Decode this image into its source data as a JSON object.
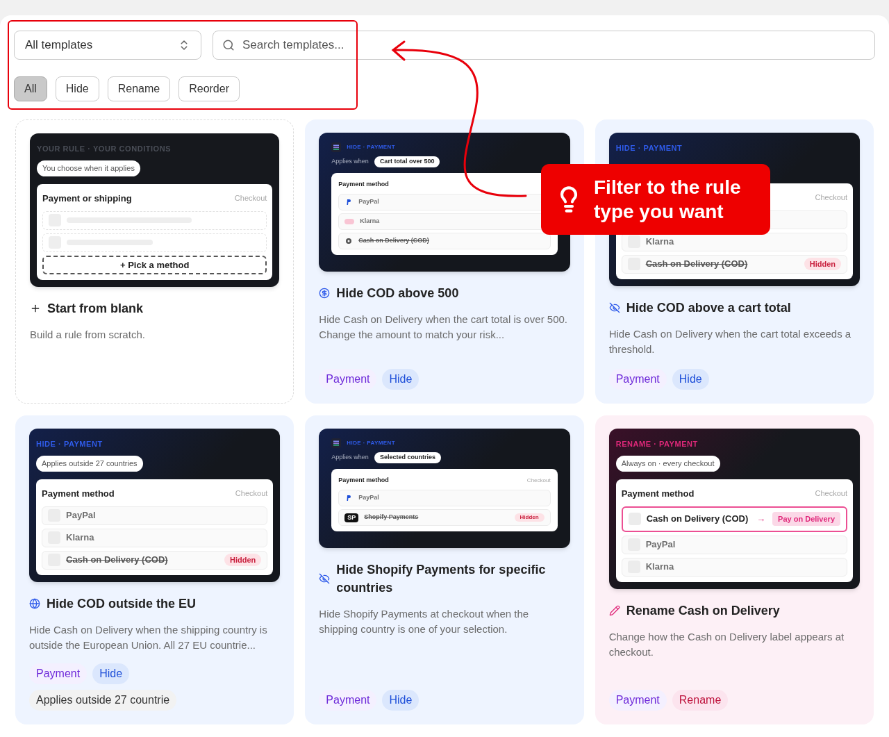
{
  "toolbar": {
    "select": {
      "value": "All templates"
    },
    "search": {
      "placeholder": "Search templates..."
    },
    "filters": [
      {
        "label": "All",
        "selected": true
      },
      {
        "label": "Hide",
        "selected": false
      },
      {
        "label": "Rename",
        "selected": false
      },
      {
        "label": "Reorder",
        "selected": false
      }
    ]
  },
  "callout": {
    "text": "Filter to the rule type you want"
  },
  "cards": [
    {
      "kind": "blank",
      "title": "Start from blank",
      "description": "Build a rule from scratch.",
      "preview": {
        "header": "YOUR RULE · YOUR CONDITIONS",
        "condition": "You choose when it applies",
        "panel_title": "Payment or shipping",
        "panel_note": "Checkout",
        "methods": [
          {
            "kind": "placeholder"
          },
          {
            "kind": "placeholder"
          }
        ],
        "add_button": "+ Pick a method"
      }
    },
    {
      "kind": "hide",
      "title": "Hide COD above 500",
      "description": "Hide Cash on Delivery when the cart total is over 500. Change the amount to match your risk...",
      "tags": [
        {
          "label": "Payment",
          "kind": "payment"
        },
        {
          "label": "Hide",
          "kind": "hide"
        }
      ],
      "preview": {
        "header": "HIDE · PAYMENT",
        "condition_prefix": "Applies when",
        "condition": "Cart total over 500",
        "panel_title": "Payment method",
        "methods": [
          {
            "kind": "normal",
            "label": "PayPal"
          },
          {
            "kind": "normal",
            "label": "Klarna"
          },
          {
            "kind": "hidden",
            "label": "Cash on Delivery (COD)"
          }
        ]
      }
    },
    {
      "kind": "hide",
      "title": "Hide COD above a cart total",
      "description": "Hide Cash on Delivery when the cart total exceeds a threshold.",
      "tags": [
        {
          "label": "Payment",
          "kind": "payment"
        },
        {
          "label": "Hide",
          "kind": "hide"
        }
      ],
      "preview": {
        "header": "HIDE · PAYMENT",
        "panel_note": "Checkout",
        "methods": [
          {
            "kind": "empty"
          },
          {
            "kind": "normal",
            "label": "Klarna"
          },
          {
            "kind": "hidden",
            "label": "Cash on Delivery (COD)",
            "badge": "Hidden"
          }
        ]
      }
    },
    {
      "kind": "hide",
      "title": "Hide COD outside the EU",
      "description": "Hide Cash on Delivery when the shipping country is outside the European Union. All 27 EU countrie...",
      "tags": [
        {
          "label": "Payment",
          "kind": "payment"
        },
        {
          "label": "Hide",
          "kind": "hide"
        }
      ],
      "note": "Applies outside 27 countrie",
      "preview": {
        "header": "HIDE · PAYMENT",
        "condition": "Applies outside 27 countries",
        "panel_title": "Payment method",
        "panel_note": "Checkout",
        "methods": [
          {
            "kind": "normal",
            "label": "PayPal"
          },
          {
            "kind": "normal",
            "label": "Klarna"
          },
          {
            "kind": "hidden",
            "label": "Cash on Delivery (COD)",
            "badge": "Hidden"
          }
        ]
      }
    },
    {
      "kind": "hide",
      "title": "Hide Shopify Payments for specific countries",
      "description": "Hide Shopify Payments at checkout when the shipping country is one of your selection.",
      "tags": [
        {
          "label": "Payment",
          "kind": "payment"
        },
        {
          "label": "Hide",
          "kind": "hide"
        }
      ],
      "preview": {
        "header": "HIDE · PAYMENT",
        "condition_prefix": "Applies when",
        "condition": "Selected countries",
        "panel_title": "Payment method",
        "panel_note": "Checkout",
        "methods": [
          {
            "kind": "normal",
            "label": "PayPal"
          },
          {
            "kind": "hidden",
            "logo_text": "SP",
            "label": "Shopify Payments",
            "badge": "Hidden"
          }
        ]
      }
    },
    {
      "kind": "rename",
      "title": "Rename Cash on Delivery",
      "description": "Change how the Cash on Delivery label appears at checkout.",
      "tags": [
        {
          "label": "Payment",
          "kind": "payment"
        },
        {
          "label": "Rename",
          "kind": "rename"
        }
      ],
      "preview": {
        "header": "RENAME · PAYMENT",
        "condition": "Always on · every checkout",
        "panel_title": "Payment method",
        "panel_note": "Checkout",
        "methods": [
          {
            "kind": "renamed",
            "label": "Cash on Delivery (COD)",
            "arrow": "→",
            "renamed_to": "Pay on Delivery"
          },
          {
            "kind": "normal",
            "label": "PayPal"
          },
          {
            "kind": "normal",
            "label": "Klarna"
          }
        ]
      }
    }
  ]
}
